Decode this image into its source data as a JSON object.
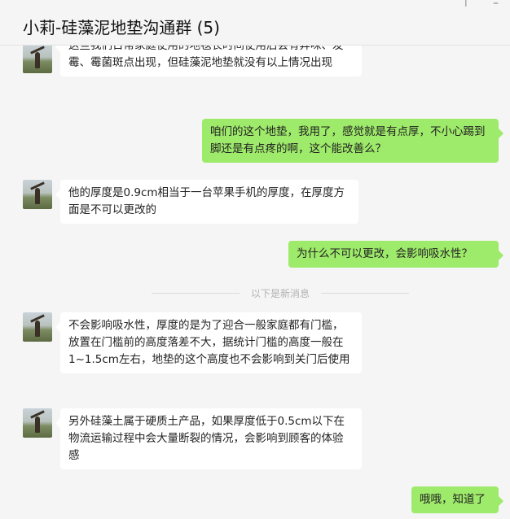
{
  "window": {
    "title": "小莉-硅藻泥地垫沟通群 (5)",
    "pin_glyph": "⊤",
    "minimize_glyph": "–"
  },
  "messages": [
    {
      "side": "left",
      "text": "这些我们日常家庭使用的地毯长时间使用后会有异味、发霉、霉菌斑点出现，但硅藻泥地垫就没有以上情况出现"
    },
    {
      "side": "right",
      "text": "咱们的这个地垫，我用了，感觉就是有点厚，不小心踢到脚还是有点疼的啊，这个能改善么？"
    },
    {
      "side": "left",
      "text": "他的厚度是0.9cm相当于一台苹果手机的厚度，在厚度方面是不可以更改的"
    },
    {
      "side": "right",
      "text": "为什么不可以更改，会影响吸水性？"
    },
    {
      "side": "left",
      "text": "不会影响吸水性，厚度的是为了迎合一般家庭都有门槛，放置在门槛前的高度落差不大，据统计门槛的高度一般在1~1.5cm左右，地垫的这个高度也不会影响到关门后使用"
    },
    {
      "side": "left",
      "text": "另外硅藻土属于硬质土产品，如果厚度低于0.5cm以下在物流运输过程中会大量断裂的情况，会影响到顾客的体验感"
    },
    {
      "side": "right",
      "text": "哦哦，知道了"
    }
  ],
  "divider": {
    "text": "以下是新消息"
  },
  "colors": {
    "outgoing_bubble": "#9eea6a",
    "incoming_bubble": "#ffffff",
    "background": "#f5f5f5"
  }
}
